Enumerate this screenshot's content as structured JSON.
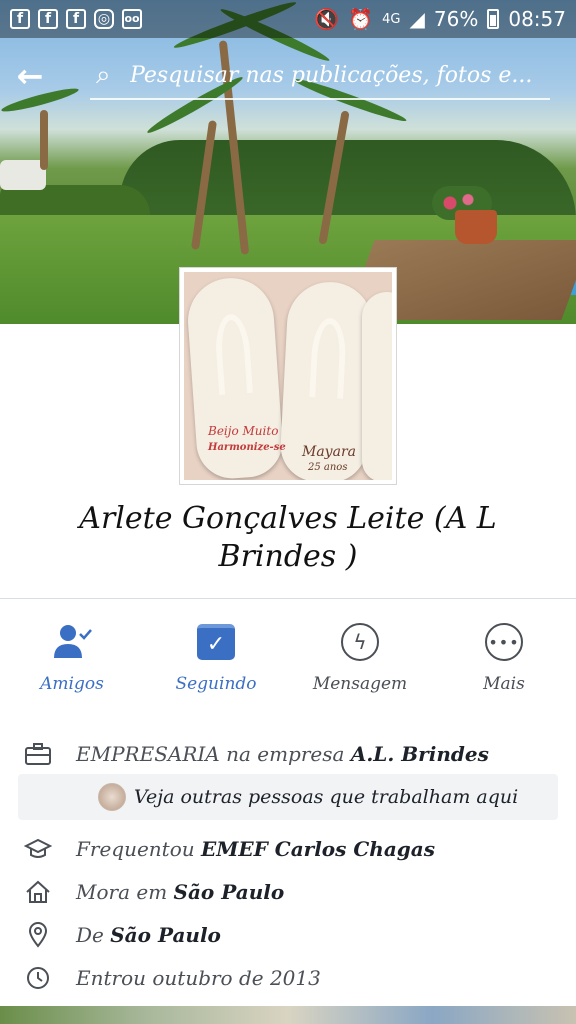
{
  "status_bar": {
    "left_icons": [
      "facebook-icon",
      "facebook-icon",
      "facebook-icon",
      "instagram-icon",
      "voicemail-icon"
    ],
    "network": "4G",
    "battery_percent": "76%",
    "time": "08:57"
  },
  "search": {
    "placeholder": "Pesquisar nas publicações, fotos e..."
  },
  "profile": {
    "name": "Arlete Gonçalves Leite (A L Brindes )",
    "photo_text": {
      "line1": "Beijo Muito",
      "line2": "Harmonize-se",
      "line3": "Mayara",
      "line4": "25 anos"
    }
  },
  "actions": [
    {
      "label": "Amigos",
      "icon": "friends-check-icon"
    },
    {
      "label": "Seguindo",
      "icon": "following-check-icon"
    },
    {
      "label": "Mensagem",
      "icon": "messenger-icon"
    },
    {
      "label": "Mais",
      "icon": "more-icon"
    }
  ],
  "info": {
    "work_prefix": "EMPRESARIA na empresa ",
    "work_company": "A.L. Brindes",
    "coworkers_text": "Veja outras pessoas que trabalham aqui",
    "education_prefix": "Frequentou ",
    "education_school": "EMEF Carlos Chagas",
    "lives_prefix": "Mora em ",
    "lives_city": "São Paulo",
    "from_prefix": "De ",
    "from_city": "São Paulo",
    "joined": "Entrou outubro de 2013"
  },
  "colors": {
    "accent": "#3b6fc4",
    "text_secondary": "#4b4f56"
  }
}
